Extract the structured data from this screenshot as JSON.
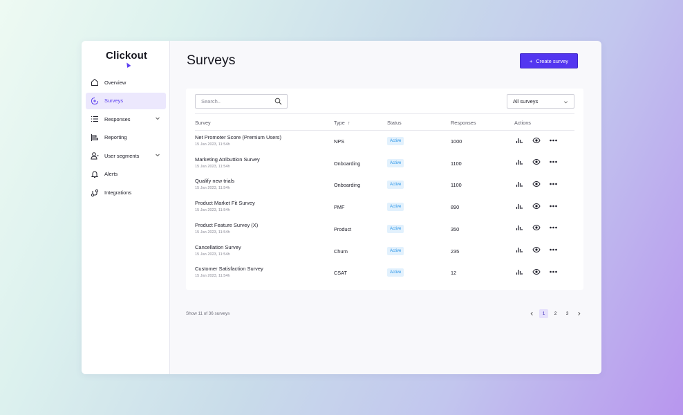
{
  "app": {
    "logo": "Clickout"
  },
  "sidebar": {
    "items": [
      {
        "label": "Overview",
        "icon": "home-icon"
      },
      {
        "label": "Surveys",
        "icon": "survey-icon",
        "active": true
      },
      {
        "label": "Responses",
        "icon": "list-icon",
        "expandable": true
      },
      {
        "label": "Reporting",
        "icon": "report-icon"
      },
      {
        "label": "User segments",
        "icon": "users-icon",
        "expandable": true
      },
      {
        "label": "Alerts",
        "icon": "bell-icon"
      },
      {
        "label": "Integrations",
        "icon": "integrations-icon"
      }
    ]
  },
  "page": {
    "title": "Surveys",
    "create_button": "Create survey",
    "create_icon": "+"
  },
  "search": {
    "placeholder": "Search.."
  },
  "filter": {
    "selected": "All surveys"
  },
  "table": {
    "columns": {
      "survey": "Survey",
      "type": "Type",
      "status": "Status",
      "responses": "Responses",
      "actions": "Actions"
    },
    "sort_indicator": "↑",
    "rows": [
      {
        "name": "Net Promoter Score (Premium Users)",
        "date": "15 Jan 2023, 11:54h",
        "type": "NPS",
        "status": "Active",
        "responses": "1000"
      },
      {
        "name": "Marketing Atributtion Survey",
        "date": "15 Jan 2023, 11:54h",
        "type": "Onboarding",
        "status": "Active",
        "responses": "1100"
      },
      {
        "name": "Qualify new trials",
        "date": "15 Jan 2023, 11:54h",
        "type": "Onboarding",
        "status": "Active",
        "responses": "1100"
      },
      {
        "name": "Product Market Fit Survey",
        "date": "15 Jan 2023, 11:54h",
        "type": "PMF",
        "status": "Active",
        "responses": "890"
      },
      {
        "name": "Product Feature Survey (X)",
        "date": "15 Jan 2023, 11:54h",
        "type": "Product",
        "status": "Active",
        "responses": "350"
      },
      {
        "name": "Cancellation Survey",
        "date": "15 Jan 2023, 11:54h",
        "type": "Churn",
        "status": "Active",
        "responses": "235"
      },
      {
        "name": "Customer Satisfaction Survey",
        "date": "15 Jan 2023, 11:54h",
        "type": "CSAT",
        "status": "Active",
        "responses": "12"
      }
    ]
  },
  "footer": {
    "summary": "Show 11 of 36 surveys",
    "pages": [
      "1",
      "2",
      "3"
    ],
    "current_page": "1"
  },
  "colors": {
    "accent": "#5336f0",
    "active_bg": "#ece8fd",
    "status_bg": "#e2f1fd",
    "status_text": "#2a95e8"
  }
}
